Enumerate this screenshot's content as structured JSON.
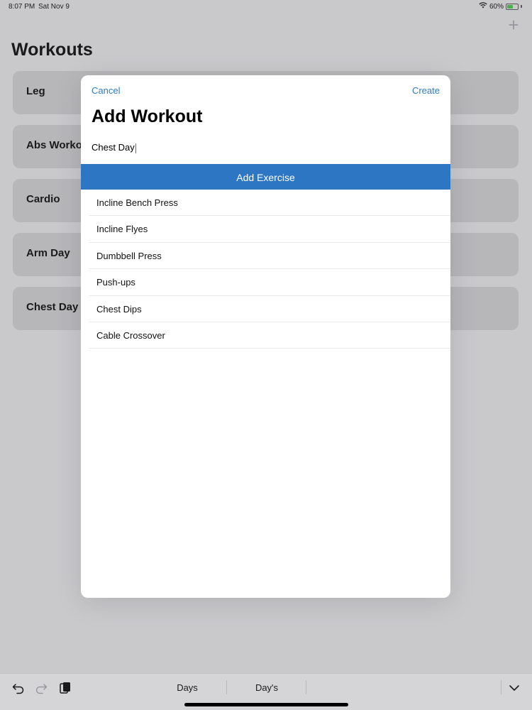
{
  "status": {
    "time": "8:07 PM",
    "date": "Sat Nov 9",
    "battery_percent": "60%",
    "battery_level": 0.6
  },
  "page": {
    "title": "Workouts",
    "add_icon": "plus-icon"
  },
  "workouts": [
    "Leg",
    "Abs Workout",
    "Cardio",
    "Arm Day",
    "Chest Day"
  ],
  "modal": {
    "cancel_label": "Cancel",
    "create_label": "Create",
    "title": "Add Workout",
    "name_value": "Chest Day",
    "add_exercise_label": "Add Exercise",
    "exercises": [
      "Incline Bench Press",
      "Incline Flyes",
      "Dumbbell Press",
      "Push-ups",
      "Chest Dips",
      "Cable Crossover"
    ]
  },
  "keyboard": {
    "suggestions": [
      "Days",
      "Day's"
    ],
    "icons": [
      "undo-icon",
      "redo-icon",
      "paste-icon",
      "chevron-down-icon"
    ]
  },
  "colors": {
    "accent": "#2f7bc4",
    "button_bg": "#2d76c4",
    "backdrop": "#c9c9cc"
  }
}
